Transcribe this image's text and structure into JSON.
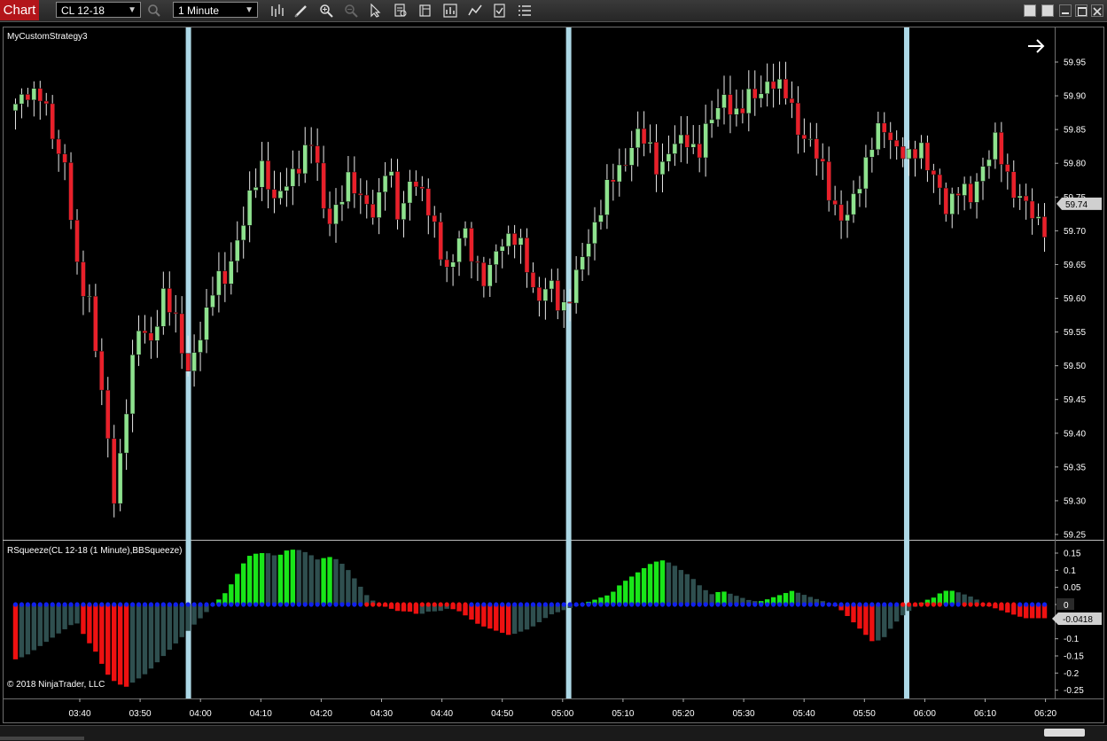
{
  "toolbar": {
    "tab_label": "Chart",
    "instrument": "CL 12-18",
    "interval": "1 Minute",
    "icons": [
      "search-icon",
      "bar-type-icon",
      "draw-pencil-icon",
      "zoom-in-icon",
      "zoom-out-icon",
      "pointer-icon",
      "data-box-icon",
      "properties-icon",
      "strategies-icon",
      "indicators-icon",
      "templates-icon",
      "menu-list-icon"
    ]
  },
  "price_panel": {
    "title": "MyCustomStrategy3",
    "current_price": "59.74"
  },
  "indicator_panel": {
    "title": "RSqueeze(CL 12-18 (1 Minute),BBSqueeze)",
    "zero_label": "0",
    "current_value": "-0.0418"
  },
  "copyright": "© 2018 NinjaTrader, LLC",
  "colors": {
    "up_candle": "#8ee28e",
    "down_candle": "#e8202a",
    "histogram_up_rising": "#19e619",
    "histogram_fading": "#2f4f4f",
    "histogram_down_falling": "#ee1111",
    "squeeze_on_dot": "#ee1111",
    "squeeze_off_dot": "#1020ee",
    "session_marker": "#add8e6",
    "tab_red": "#b3151a"
  },
  "chart_data": [
    {
      "type": "candlestick",
      "title": "MyCustomStrategy3",
      "symbol": "CL 12-18",
      "interval": "1 Minute",
      "x_tick_labels": [
        "03:40",
        "03:50",
        "04:00",
        "04:10",
        "04:20",
        "04:30",
        "04:40",
        "04:50",
        "05:00",
        "05:10",
        "05:20",
        "05:30",
        "05:40",
        "05:50",
        "06:00",
        "06:10",
        "06:20"
      ],
      "y_tick_labels": [
        "59.95",
        "59.90",
        "59.85",
        "59.80",
        "59.75",
        "59.70",
        "59.65",
        "59.60",
        "59.55",
        "59.50",
        "59.45",
        "59.40",
        "59.35",
        "59.30",
        "59.25"
      ],
      "ylim": [
        59.235,
        59.99
      ],
      "close_path": [
        59.88,
        59.91,
        59.9,
        59.84,
        59.8,
        59.63,
        59.6,
        59.45,
        59.3,
        59.45,
        59.56,
        59.54,
        59.6,
        59.57,
        59.48,
        59.55,
        59.63,
        59.62,
        59.7,
        59.75,
        59.8,
        59.74,
        59.77,
        59.81,
        59.83,
        59.72,
        59.73,
        59.78,
        59.75,
        59.71,
        59.82,
        59.7,
        59.79,
        59.75,
        59.68,
        59.64,
        59.7,
        59.66,
        59.62,
        59.68,
        59.7,
        59.66,
        59.6,
        59.62,
        59.58,
        59.62,
        59.67,
        59.73,
        59.77,
        59.8,
        59.84,
        59.83,
        59.79,
        59.82,
        59.85,
        59.8,
        59.87,
        59.9,
        59.86,
        59.91,
        59.89,
        59.93,
        59.91,
        59.85,
        59.84,
        59.79,
        59.74,
        59.71,
        59.77,
        59.83,
        59.85,
        59.83,
        59.8,
        59.83,
        59.78,
        59.73,
        59.77,
        59.74,
        59.8,
        59.83,
        59.78,
        59.75,
        59.72,
        59.71
      ],
      "current_price": 59.74,
      "session_markers": [
        "03:58",
        "05:01",
        "05:57"
      ],
      "grid": false
    },
    {
      "type": "bar",
      "title": "RSqueeze(CL 12-18 (1 Minute),BBSqueeze)",
      "y_tick_labels": [
        "0.15",
        "0.1",
        "0.05",
        "0",
        "-0.1",
        "-0.15",
        "-0.2",
        "-0.25"
      ],
      "ylim": [
        -0.27,
        0.175
      ],
      "momentum_path": [
        -0.16,
        -0.15,
        -0.13,
        -0.11,
        -0.09,
        -0.07,
        -0.05,
        -0.1,
        -0.14,
        -0.2,
        -0.23,
        -0.24,
        -0.22,
        -0.2,
        -0.17,
        -0.14,
        -0.11,
        -0.08,
        -0.05,
        -0.02,
        0.01,
        0.04,
        0.09,
        0.14,
        0.15,
        0.15,
        0.14,
        0.16,
        0.16,
        0.15,
        0.13,
        0.14,
        0.13,
        0.1,
        0.06,
        0.02,
        0.0,
        -0.01,
        -0.02,
        -0.02,
        -0.03,
        -0.02,
        -0.02,
        -0.01,
        -0.02,
        -0.04,
        -0.06,
        -0.07,
        -0.08,
        -0.09,
        -0.08,
        -0.07,
        -0.05,
        -0.03,
        -0.02,
        -0.01,
        0.0,
        0.01,
        0.02,
        0.03,
        0.06,
        0.08,
        0.1,
        0.12,
        0.13,
        0.12,
        0.1,
        0.08,
        0.05,
        0.03,
        0.04,
        0.03,
        0.02,
        0.01,
        0.01,
        0.02,
        0.03,
        0.04,
        0.03,
        0.02,
        0.01,
        0.0,
        -0.02,
        -0.05,
        -0.08,
        -0.11,
        -0.1,
        -0.06,
        -0.03,
        -0.01,
        0.01,
        0.02,
        0.04,
        0.04,
        0.03,
        0.02,
        0.0,
        -0.01,
        -0.02,
        -0.03,
        -0.04,
        -0.04,
        -0.04
      ],
      "current_value": -0.0418,
      "grid": false
    }
  ]
}
